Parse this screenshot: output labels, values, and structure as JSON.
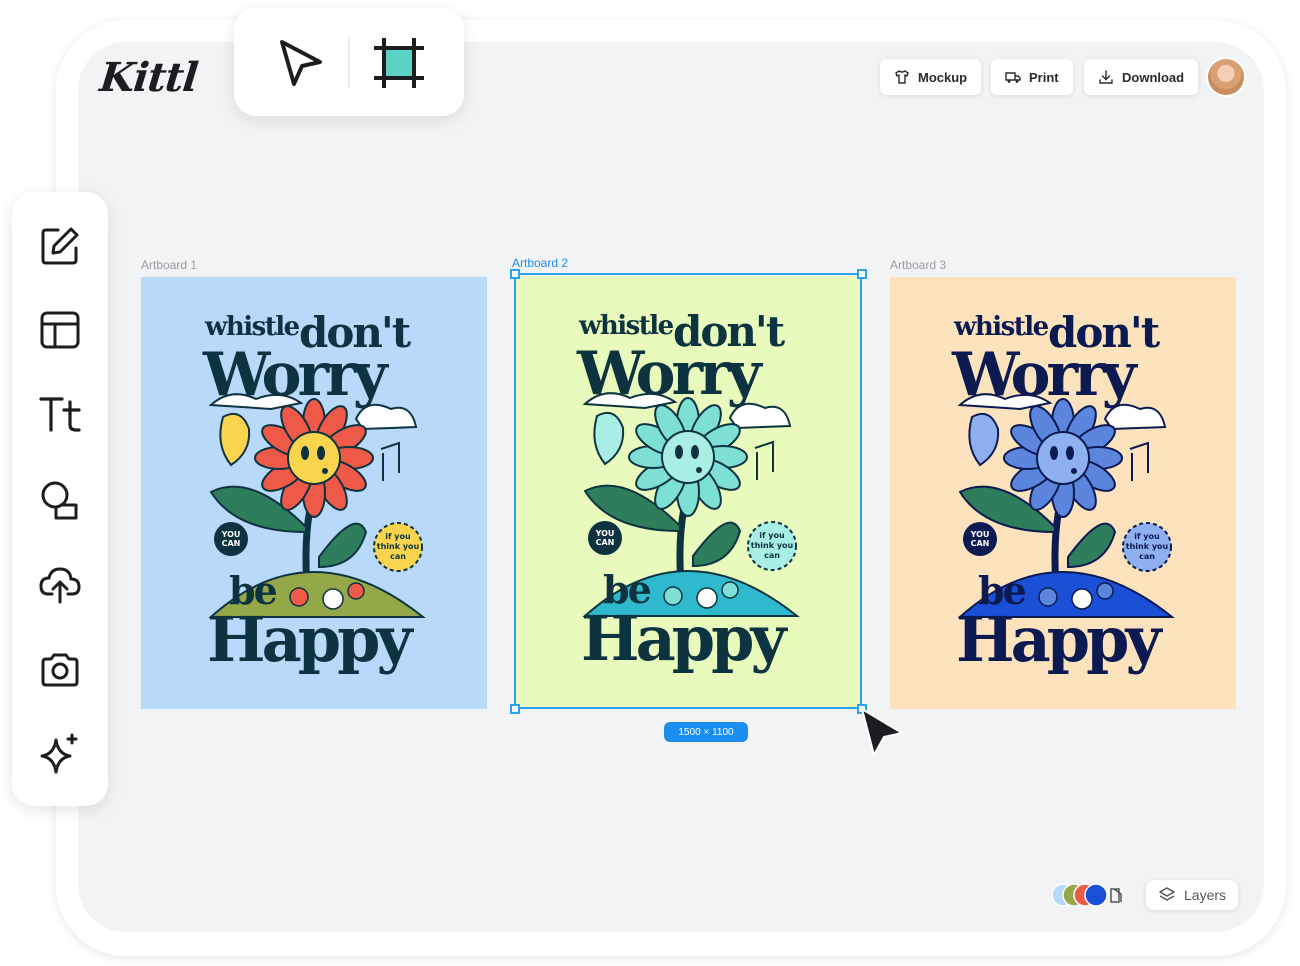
{
  "app": {
    "logo": "Kittl"
  },
  "header": {
    "mockup_label": "Mockup",
    "print_label": "Print",
    "download_label": "Download"
  },
  "artboards": [
    {
      "label": "Artboard 1",
      "bg": "#b9d9fb",
      "flower": "#ef5a48",
      "center": "#fbd44e",
      "hill": "#94a84a",
      "ink": "#0d3340"
    },
    {
      "label": "Artboard 2",
      "bg": "#e8fbbd",
      "flower": "#7ee0d5",
      "center": "#a8eee5",
      "hill": "#2fb9cc",
      "ink": "#0d3340"
    },
    {
      "label": "Artboard 3",
      "bg": "#fde3bd",
      "flower": "#5c86de",
      "center": "#8fb0ef",
      "hill": "#1a4fd8",
      "ink": "#0c1a52"
    }
  ],
  "poster": {
    "line1a": "whistle",
    "line1b": "don't",
    "line2": "Worry",
    "line3": "be",
    "line4": "Happy",
    "badge_left": [
      "YOU",
      "CAN"
    ],
    "badge_right": [
      "if you",
      "think you",
      "can"
    ]
  },
  "selection": {
    "size_label": "1500 × 1100",
    "color": "#1a8ff0"
  },
  "footer": {
    "layers_label": "Layers"
  },
  "palette_colors": [
    "#b9d9fb",
    "#94a84a",
    "#ef5a48",
    "#1a4fd8"
  ]
}
